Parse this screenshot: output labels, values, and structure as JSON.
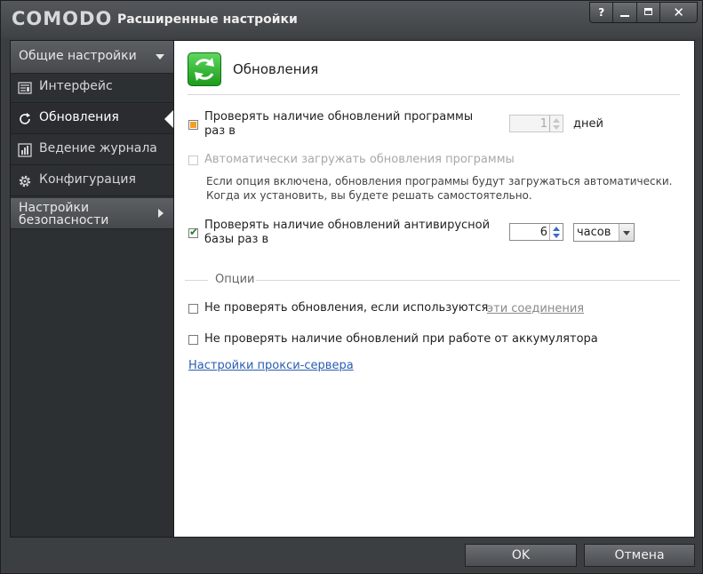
{
  "window": {
    "brand": "COMODO",
    "title": "Расширенные настройки",
    "help_label": "?"
  },
  "sidebar": {
    "header": "Общие настройки",
    "items": [
      {
        "label": "Интерфейс",
        "icon": "interface-icon"
      },
      {
        "label": "Обновления",
        "icon": "refresh-icon",
        "active": true
      },
      {
        "label": "Ведение журнала",
        "icon": "log-chart-icon"
      },
      {
        "label": "Конфигурация",
        "icon": "gear-icon"
      }
    ],
    "security": {
      "line1": "Настройки",
      "line2": "безопасности"
    }
  },
  "main": {
    "title": "Обновления",
    "program_updates": {
      "label_line1": "Проверять наличие обновлений программы",
      "label_line2": "раз в",
      "value": "1",
      "unit": "дней",
      "state": "partial"
    },
    "auto_download": {
      "label": "Автоматически загружать обновления программы",
      "desc_line1": "Если опция включена, обновления программы будут загружаться автоматически.",
      "desc_line2": "Когда их установить, вы будете решать самостоятельно.",
      "checked": false,
      "disabled": true
    },
    "av_updates": {
      "label_line1": "Проверять наличие обновлений антивирусной",
      "label_line2": "базы раз в",
      "value": "6",
      "unit": "часов",
      "checked": true
    },
    "options_title": "Опции",
    "no_check_connections": {
      "label": "Не проверять обновления, если используются",
      "link": "эти соединения",
      "checked": false
    },
    "no_check_battery": {
      "label": "Не проверять наличие обновлений при работе от аккумулятора",
      "checked": false
    },
    "proxy_link": "Настройки прокси-сервера"
  },
  "buttons": {
    "ok": "OK",
    "cancel": "Отмена"
  },
  "colors": {
    "accent_green": "#2fb82f",
    "link_blue": "#2a5db0",
    "partial_orange": "#f0a028"
  }
}
